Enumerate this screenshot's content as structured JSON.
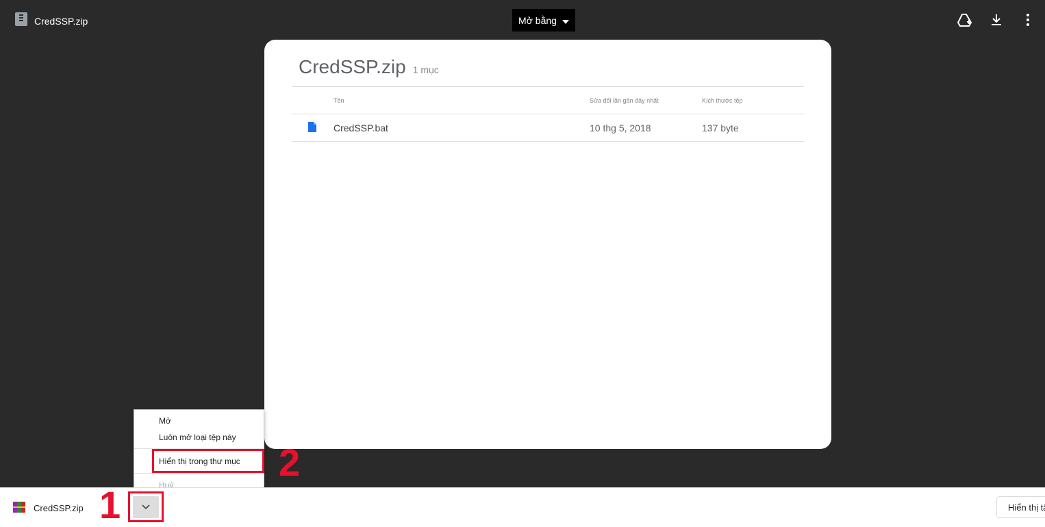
{
  "topbar": {
    "file_name": "CredSSP.zip",
    "open_with_label": "Mở bằng"
  },
  "preview": {
    "title": "CredSSP.zip",
    "item_count": "1 mục",
    "columns": [
      "Tên",
      "Sửa đổi lần gần đây nhất",
      "Kích thước tệp"
    ],
    "rows": [
      {
        "name": "CredSSP.bat",
        "modified": "10 thg 5, 2018",
        "size": "137 byte"
      }
    ]
  },
  "context_menu": {
    "items": [
      "Mở",
      "Luôn mở loại tệp này",
      "Hiển thị trong thư mục",
      "Huỷ"
    ]
  },
  "annotations": {
    "step1": "1",
    "step2": "2"
  },
  "download_bar": {
    "file_name": "CredSSP.zip",
    "show_all_label": "Hiển thị tất cả"
  },
  "colors": {
    "accent_red": "#e8112d",
    "file_icon_blue": "#1a73e8"
  }
}
